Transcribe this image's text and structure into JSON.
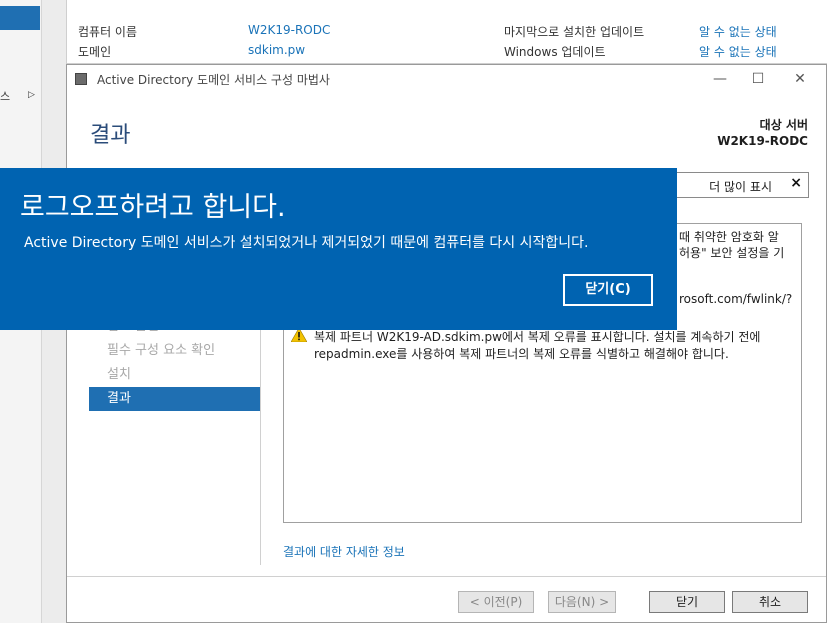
{
  "background": {
    "left_fragment": "스",
    "info_rows": [
      {
        "label": "컴퓨터 이름",
        "value": "W2K19-RODC",
        "label2": "마지막으로 설치한 업데이트",
        "value2": "알 수 없는 상태"
      },
      {
        "label": "도메인",
        "value": "sdkim.pw",
        "label2": "Windows 업데이트",
        "value2": "알 수 없는 상태"
      }
    ]
  },
  "wizard": {
    "title": "Active Directory 도메인 서비스 구성 마법사",
    "heading": "결과",
    "target_label": "대상 서버",
    "target_value": "W2K19-RODC",
    "show_more": "더 많이 표시",
    "close_x": "×",
    "nav": [
      {
        "label": "검토 옵션",
        "active": false
      },
      {
        "label": "필수 구성 요소 확인",
        "active": false
      },
      {
        "label": "설치",
        "active": false
      },
      {
        "label": "결과",
        "active": true
      }
    ],
    "result_lines": [
      "때 취약한 암호화 알",
      "허용\" 보안 설정을 기",
      "rosoft.com/fwlink/?",
      "복제 파트너 W2K19-AD.sdkim.pw에서 복제 오류를 표시합니다. 설치를 계속하기 전에",
      "repadmin.exe를 사용하여 복제 파트너의 복제 오류를 식별하고 해결해야 합니다."
    ],
    "more_info_link": "결과에 대한 자세한 정보",
    "buttons": {
      "prev": "< 이전(P)",
      "next": "다음(N) >",
      "close": "닫기",
      "cancel": "취소"
    }
  },
  "notification": {
    "title": "로그오프하려고 합니다.",
    "message": "Active Directory 도메인 서비스가 설치되었거나 제거되었기 때문에 컴퓨터를 다시 시작합니다.",
    "close_button": "닫기(C)",
    "color": "#0063b1"
  }
}
